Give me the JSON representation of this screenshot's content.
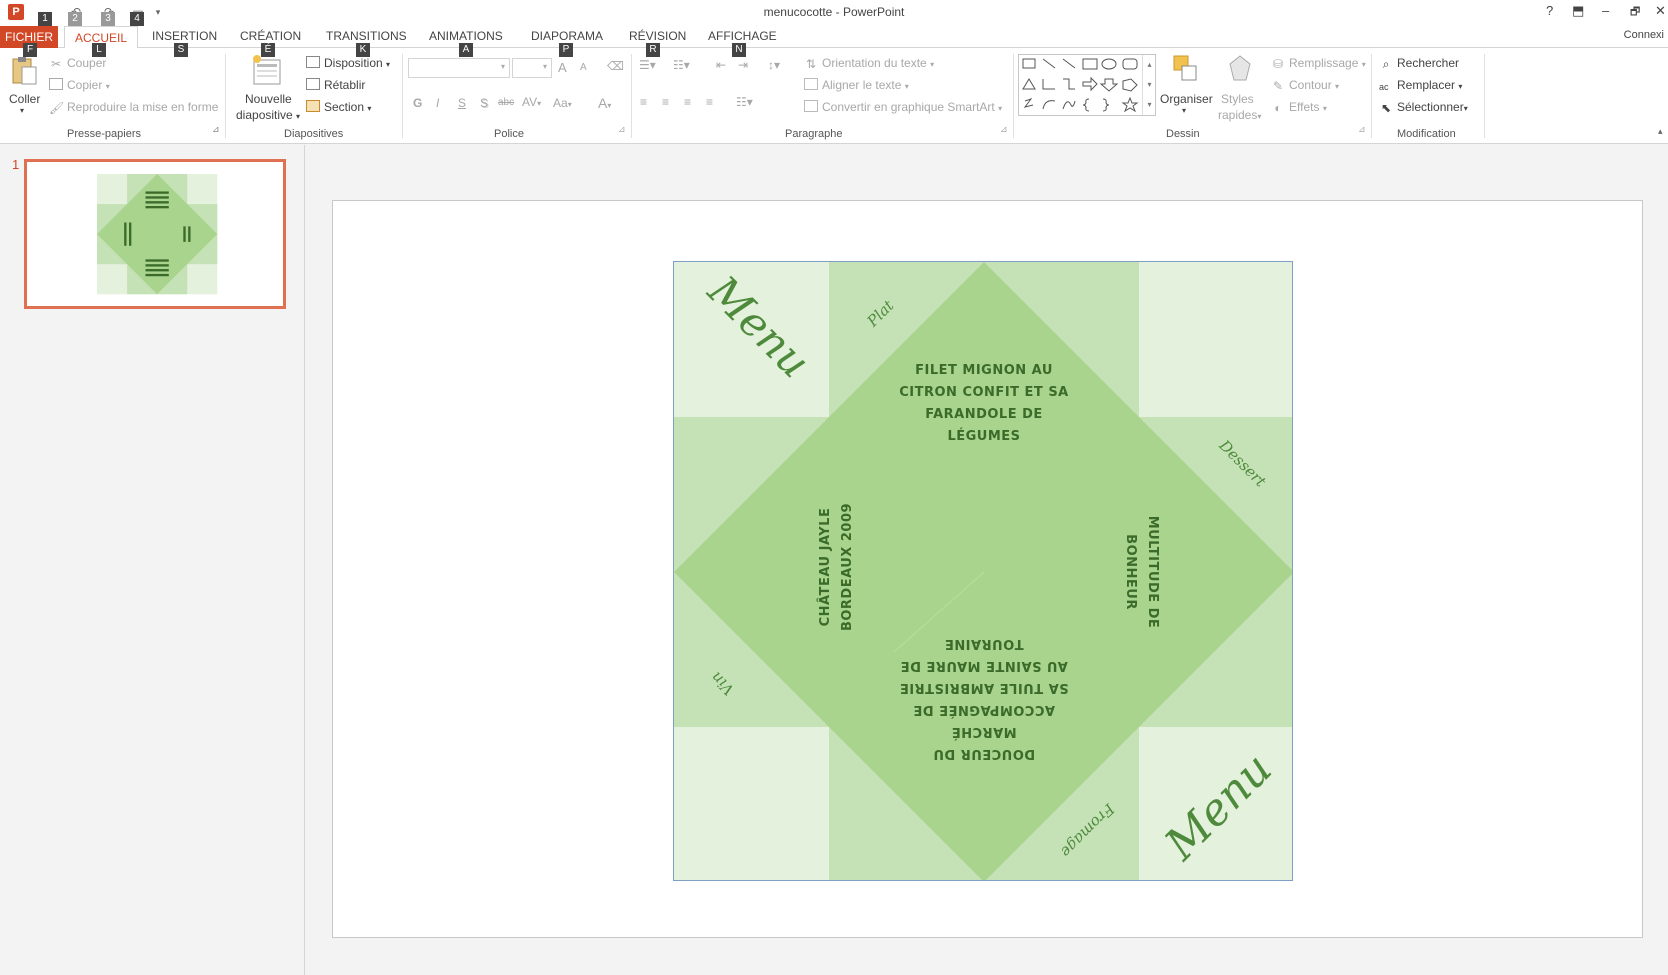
{
  "app": {
    "window_title": "menucocotte - PowerPoint",
    "logo_letter": "P",
    "signin": "Connexi"
  },
  "window_controls": {
    "help": "?",
    "ribbon_display": "⬒",
    "minimize": "–",
    "restore": "🗗",
    "close": "✕"
  },
  "keytips": {
    "qat": [
      "1",
      "2",
      "3",
      "4"
    ],
    "tabs": [
      "F",
      "L",
      "S",
      "É",
      "K",
      "A",
      "P",
      "R",
      "N"
    ]
  },
  "tabs": {
    "fichier": "FICHIER",
    "accueil": "ACCUEIL",
    "insertion": "INSERTION",
    "creation": "CRÉATION",
    "transitions": "TRANSITIONS",
    "animations": "ANIMATIONS",
    "diaporama": "DIAPORAMA",
    "revision": "RÉVISION",
    "affichage": "AFFICHAGE"
  },
  "ribbon": {
    "presse_papiers": {
      "label": "Presse-papiers",
      "coller": "Coller",
      "couper": "Couper",
      "copier": "Copier",
      "reproduire": "Reproduire la mise en forme"
    },
    "diapositives": {
      "label": "Diapositives",
      "nouvelle_1": "Nouvelle",
      "nouvelle_2": "diapositive",
      "disposition": "Disposition",
      "retablir": "Rétablir",
      "section": "Section"
    },
    "police": {
      "label": "Police",
      "bold": "G",
      "italic": "I",
      "underline": "S",
      "shadow": "S",
      "strike": "abc",
      "spacing": "AV",
      "case": "Aa",
      "grow": "A",
      "shrink": "A",
      "color": "A"
    },
    "paragraphe": {
      "label": "Paragraphe",
      "orientation": "Orientation du texte",
      "aligner": "Aligner le texte",
      "smartart": "Convertir en graphique SmartArt"
    },
    "dessin": {
      "label": "Dessin",
      "organiser": "Organiser",
      "styles_1": "Styles",
      "styles_2": "rapides",
      "remplissage": "Remplissage",
      "contour": "Contour",
      "effets": "Effets"
    },
    "modification": {
      "label": "Modification",
      "rechercher": "Rechercher",
      "remplacer": "Remplacer",
      "selectionner": "Sélectionner"
    }
  },
  "slides_pane": {
    "slide_number": "1"
  },
  "slide": {
    "corner_tl": "Menu",
    "corner_br": "Menu",
    "flap_plat": "Plat",
    "flap_dessert": "Dessert",
    "flap_fromage": "Fromage",
    "flap_vin": "Vin",
    "top_text": [
      "FILET MIGNON AU",
      "CITRON CONFIT ET SA",
      "FARANDOLE DE",
      "LÉGUMES"
    ],
    "right_text": [
      "MULTITUDE DE",
      "BONHEUR"
    ],
    "bottom_text": [
      "DOUCEUR DU",
      "MARCHÉ",
      "ACCOMPAGNÉE DE",
      "SA TUILE AMBRISTRIE",
      "AU SAINTE MAURE DE",
      "TOURAINE"
    ],
    "left_text": [
      "CHÂTEAU JAYLE",
      "BORDEAUX 2009"
    ]
  },
  "colors": {
    "accent": "#d24726",
    "slide_light": "#e4f1dc",
    "slide_mid": "#c5e2b7",
    "slide_diamond": "#a9d48d",
    "text_green": "#3a6b2a"
  }
}
